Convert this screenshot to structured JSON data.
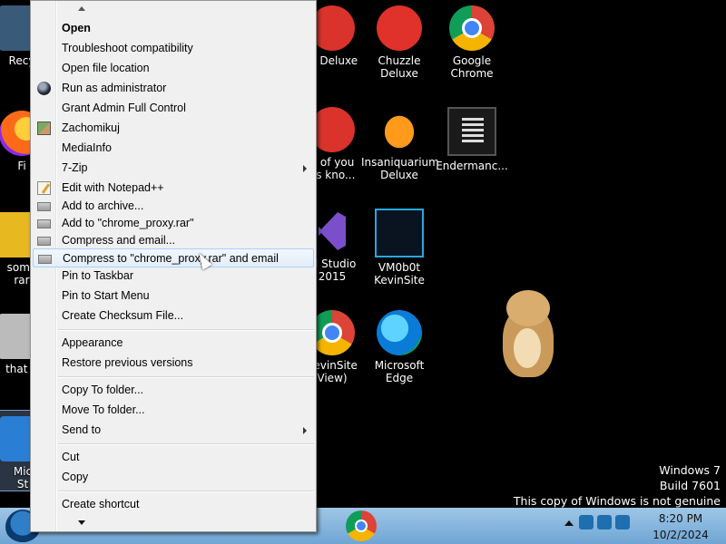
{
  "desktop": {
    "icons": [
      {
        "label": "Recy",
        "icon": "recycle-bin-icon"
      },
      {
        "label": "Fi",
        "icon": "firefox-icon"
      },
      {
        "label": "some\nrar",
        "icon": "folder-icon"
      },
      {
        "label": "that b",
        "icon": "trash-icon"
      },
      {
        "label": "Mic\nSt",
        "icon": "store-icon"
      },
      {
        "label": "le Deluxe",
        "icon": "game-icon"
      },
      {
        "label": "Chuzzle\nDeluxe",
        "icon": "chuzzle-icon"
      },
      {
        "label": "Google\nChrome",
        "icon": "chrome-icon"
      },
      {
        "label": "e of you\nds kno...",
        "icon": "game-icon"
      },
      {
        "label": "Insaniquarium\nDeluxe",
        "icon": "fish-icon"
      },
      {
        "label": "Endermanc...",
        "icon": "terminal-icon"
      },
      {
        "label": "al Studio\n2015",
        "icon": "visual-studio-icon"
      },
      {
        "label": "VM0b0t\nKevinSite",
        "icon": "monitor-icon"
      },
      {
        "label": "KevinSite\nView)",
        "icon": "chrome-icon"
      },
      {
        "label": "Microsoft\nEdge",
        "icon": "edge-icon"
      }
    ]
  },
  "context_menu": {
    "items": [
      {
        "label": "Open"
      },
      {
        "label": "Troubleshoot compatibility"
      },
      {
        "label": "Open file location"
      },
      {
        "label": "Run as administrator"
      },
      {
        "label": "Grant Admin Full Control"
      },
      {
        "label": "Zachomikuj"
      },
      {
        "label": "MediaInfo"
      },
      {
        "label": "7-Zip"
      },
      {
        "label": "Edit with Notepad++"
      },
      {
        "label": "Add to archive..."
      },
      {
        "label": "Add to \"chrome_proxy.rar\""
      },
      {
        "label": "Compress and email..."
      },
      {
        "label": "Compress to \"chrome_proxy.rar\" and email"
      },
      {
        "label": "Pin to Taskbar"
      },
      {
        "label": "Pin to Start Menu"
      },
      {
        "label": "Create Checksum File..."
      },
      {
        "label": "Appearance"
      },
      {
        "label": "Restore previous versions"
      },
      {
        "label": "Copy To folder..."
      },
      {
        "label": "Move To folder..."
      },
      {
        "label": "Send to"
      },
      {
        "label": "Cut"
      },
      {
        "label": "Copy"
      },
      {
        "label": "Create shortcut"
      }
    ]
  },
  "watermark": {
    "line1": "Windows 7",
    "line2": "Build 7601",
    "line3": "This copy of Windows is not genuine"
  },
  "taskbar": {
    "time": "8:20 PM",
    "date": "10/2/2024"
  }
}
